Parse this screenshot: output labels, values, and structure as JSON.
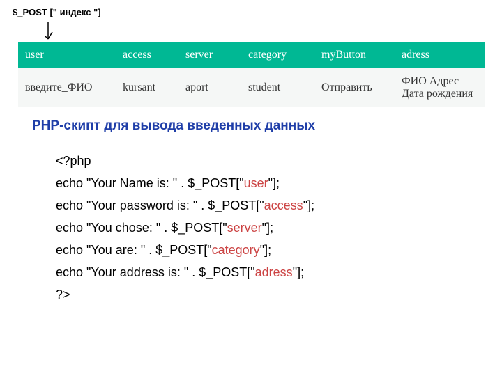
{
  "annotation": "$_POST [\" индекс \"]",
  "table": {
    "headers": [
      "user",
      "access",
      "server",
      "category",
      "myButton",
      "adress"
    ],
    "row": [
      "введите_ФИО",
      "kursant",
      "aport",
      "student",
      "Отправить",
      "ФИО Адрес Дата рождения"
    ]
  },
  "heading": "PHP-скипт для вывода введенных данных",
  "code": {
    "open": "<?php",
    "lines": [
      {
        "pre": "echo \"Your Name is: \" . $_POST[\"",
        "key": "user",
        "post": "\"];"
      },
      {
        "pre": "echo \"Your password is: \" . $_POST[\"",
        "key": "access",
        "post": "\"];"
      },
      {
        "pre": "echo \"You chose: \" . $_POST[\"",
        "key": "server",
        "post": "\"];"
      },
      {
        "pre": "echo \"You are: \" . $_POST[\"",
        "key": "category",
        "post": "\"];"
      },
      {
        "pre": "echo \"Your address is: \" . $_POST[\"",
        "key": "adress",
        "post": "\"];"
      }
    ],
    "close": "?>"
  }
}
